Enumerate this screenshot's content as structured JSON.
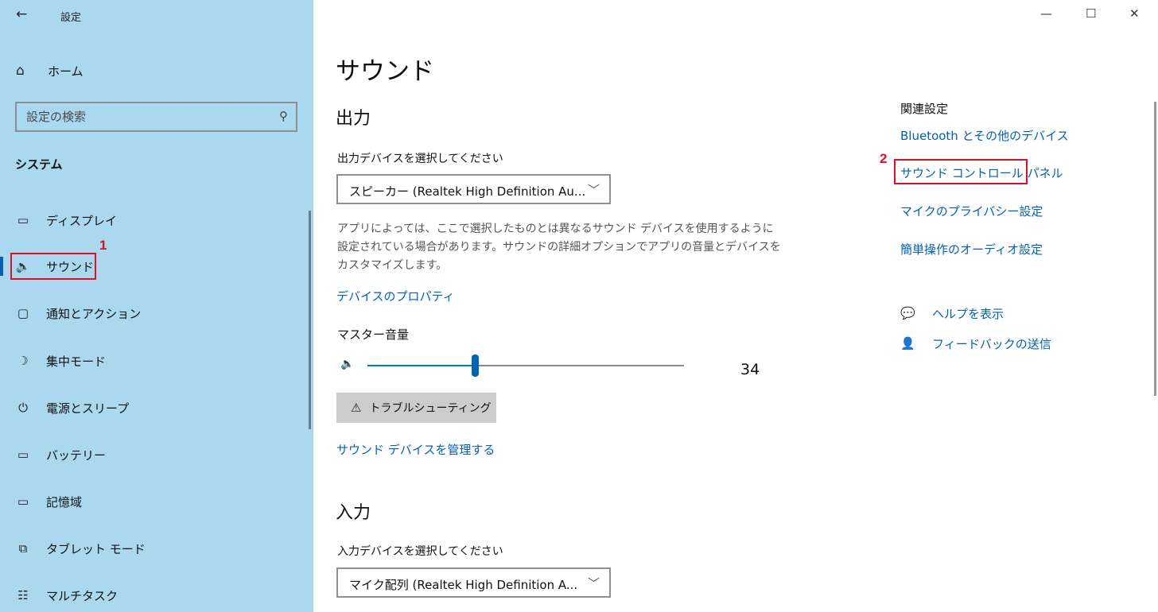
{
  "window": {
    "back_icon": "←",
    "title": "設定",
    "controls": [
      "—",
      "☐",
      "✕"
    ]
  },
  "sidebar": {
    "home": {
      "icon": "⌂",
      "label": "ホーム"
    },
    "search": {
      "placeholder": "設定の検索",
      "icon": "⚲"
    },
    "section_title": "システム",
    "items": [
      {
        "icon": "▭",
        "label": "ディスプレイ",
        "active": false
      },
      {
        "icon": "🔈",
        "label": "サウンド",
        "active": true
      },
      {
        "icon": "▢",
        "label": "通知とアクション",
        "active": false
      },
      {
        "icon": "☽",
        "label": "集中モード",
        "active": false
      },
      {
        "icon": "⏻",
        "label": "電源とスリープ",
        "active": false
      },
      {
        "icon": "▭",
        "label": "バッテリー",
        "active": false
      },
      {
        "icon": "▭",
        "label": "記憶域",
        "active": false
      },
      {
        "icon": "⧉",
        "label": "タブレット モード",
        "active": false
      },
      {
        "icon": "☷",
        "label": "マルチタスク",
        "active": false
      }
    ]
  },
  "annotations": {
    "marker1": "1",
    "marker2": "2"
  },
  "main": {
    "title": "サウンド",
    "output": {
      "heading": "出力",
      "device_label": "出力デバイスを選択してください",
      "device_value": "スピーカー (Realtek High Definition Au...",
      "description": "アプリによっては、ここで選択したものとは異なるサウンド デバイスを使用するように設定されている場合があります。サウンドの詳細オプションでアプリの音量とデバイスをカスタマイズします。",
      "properties_link": "デバイスのプロパティ",
      "master_volume_label": "マスター音量",
      "volume": 34,
      "volume_text": "34",
      "troubleshoot_label": "トラブルシューティング",
      "manage_link": "サウンド デバイスを管理する"
    },
    "input": {
      "heading": "入力",
      "device_label": "入力デバイスを選択してください",
      "device_value": "マイク配列 (Realtek High Definition A..."
    }
  },
  "related": {
    "title": "関連設定",
    "links": [
      "Bluetooth とその他のデバイス",
      "サウンド コントロール パネル",
      "マイクのプライバシー設定",
      "簡単操作のオーディオ設定"
    ],
    "help": "ヘルプを表示",
    "feedback": "フィードバックの送信"
  },
  "colors": {
    "sidebar_bg": "#a9d8ef",
    "accent": "#0063b1",
    "link": "#0060c0",
    "annotation": "#e01020"
  }
}
